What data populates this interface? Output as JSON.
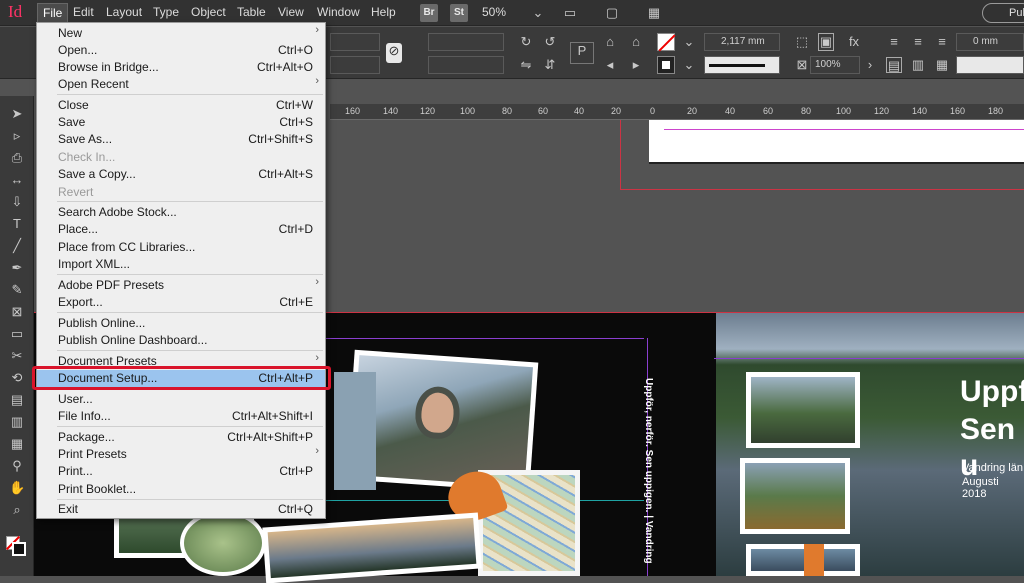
{
  "app": {
    "logo": "Id"
  },
  "menubar": {
    "items": [
      "File",
      "Edit",
      "Layout",
      "Type",
      "Object",
      "Table",
      "View",
      "Window",
      "Help"
    ],
    "bridge_badge": "Br",
    "stock_badge": "St",
    "zoom": "50%",
    "publish_button": "Pub"
  },
  "control_panel": {
    "stroke_weight": "2,117 mm",
    "opacity": "100%",
    "offset": "0 mm"
  },
  "ruler": {
    "labels": [
      "160",
      "140",
      "120",
      "100",
      "80",
      "60",
      "40",
      "20",
      "0",
      "20",
      "40",
      "60",
      "80",
      "100",
      "120",
      "140",
      "160",
      "180"
    ]
  },
  "file_menu": {
    "items": [
      {
        "label": "New",
        "shortcut": "",
        "submenu": true
      },
      {
        "label": "Open...",
        "shortcut": "Ctrl+O"
      },
      {
        "label": "Browse in Bridge...",
        "shortcut": "Ctrl+Alt+O"
      },
      {
        "label": "Open Recent",
        "shortcut": "",
        "submenu": true
      },
      {
        "label": "Close",
        "shortcut": "Ctrl+W"
      },
      {
        "label": "Save",
        "shortcut": "Ctrl+S"
      },
      {
        "label": "Save As...",
        "shortcut": "Ctrl+Shift+S"
      },
      {
        "label": "Check In...",
        "shortcut": "",
        "disabled": true
      },
      {
        "label": "Save a Copy...",
        "shortcut": "Ctrl+Alt+S"
      },
      {
        "label": "Revert",
        "shortcut": "",
        "disabled": true
      },
      {
        "label": "Search Adobe Stock...",
        "shortcut": ""
      },
      {
        "label": "Place...",
        "shortcut": "Ctrl+D"
      },
      {
        "label": "Place from CC Libraries...",
        "shortcut": ""
      },
      {
        "label": "Import XML...",
        "shortcut": ""
      },
      {
        "label": "Adobe PDF Presets",
        "shortcut": "",
        "submenu": true
      },
      {
        "label": "Export...",
        "shortcut": "Ctrl+E"
      },
      {
        "label": "Publish Online...",
        "shortcut": ""
      },
      {
        "label": "Publish Online Dashboard...",
        "shortcut": ""
      },
      {
        "label": "Document Presets",
        "shortcut": "",
        "submenu": true
      },
      {
        "label": "Document Setup...",
        "shortcut": "Ctrl+Alt+P",
        "selected": true
      },
      {
        "label": "User...",
        "shortcut": ""
      },
      {
        "label": "File Info...",
        "shortcut": "Ctrl+Alt+Shift+I"
      },
      {
        "label": "Package...",
        "shortcut": "Ctrl+Alt+Shift+P"
      },
      {
        "label": "Print Presets",
        "shortcut": "",
        "submenu": true
      },
      {
        "label": "Print...",
        "shortcut": "Ctrl+P"
      },
      {
        "label": "Print Booklet...",
        "shortcut": ""
      },
      {
        "label": "Exit",
        "shortcut": "Ctrl+Q"
      }
    ]
  },
  "document": {
    "vertical_text": "Uppför, nerför. Sen uppigen.  |  Vandring",
    "headline_1": "Uppf",
    "headline_2": "Sen u",
    "sub_1": "Vandring län",
    "sub_2": "Augusti 2018"
  },
  "colors": {
    "highlight_border": "#d9142b",
    "selected_row": "#9bc4ee",
    "logo": "#ff3366"
  }
}
